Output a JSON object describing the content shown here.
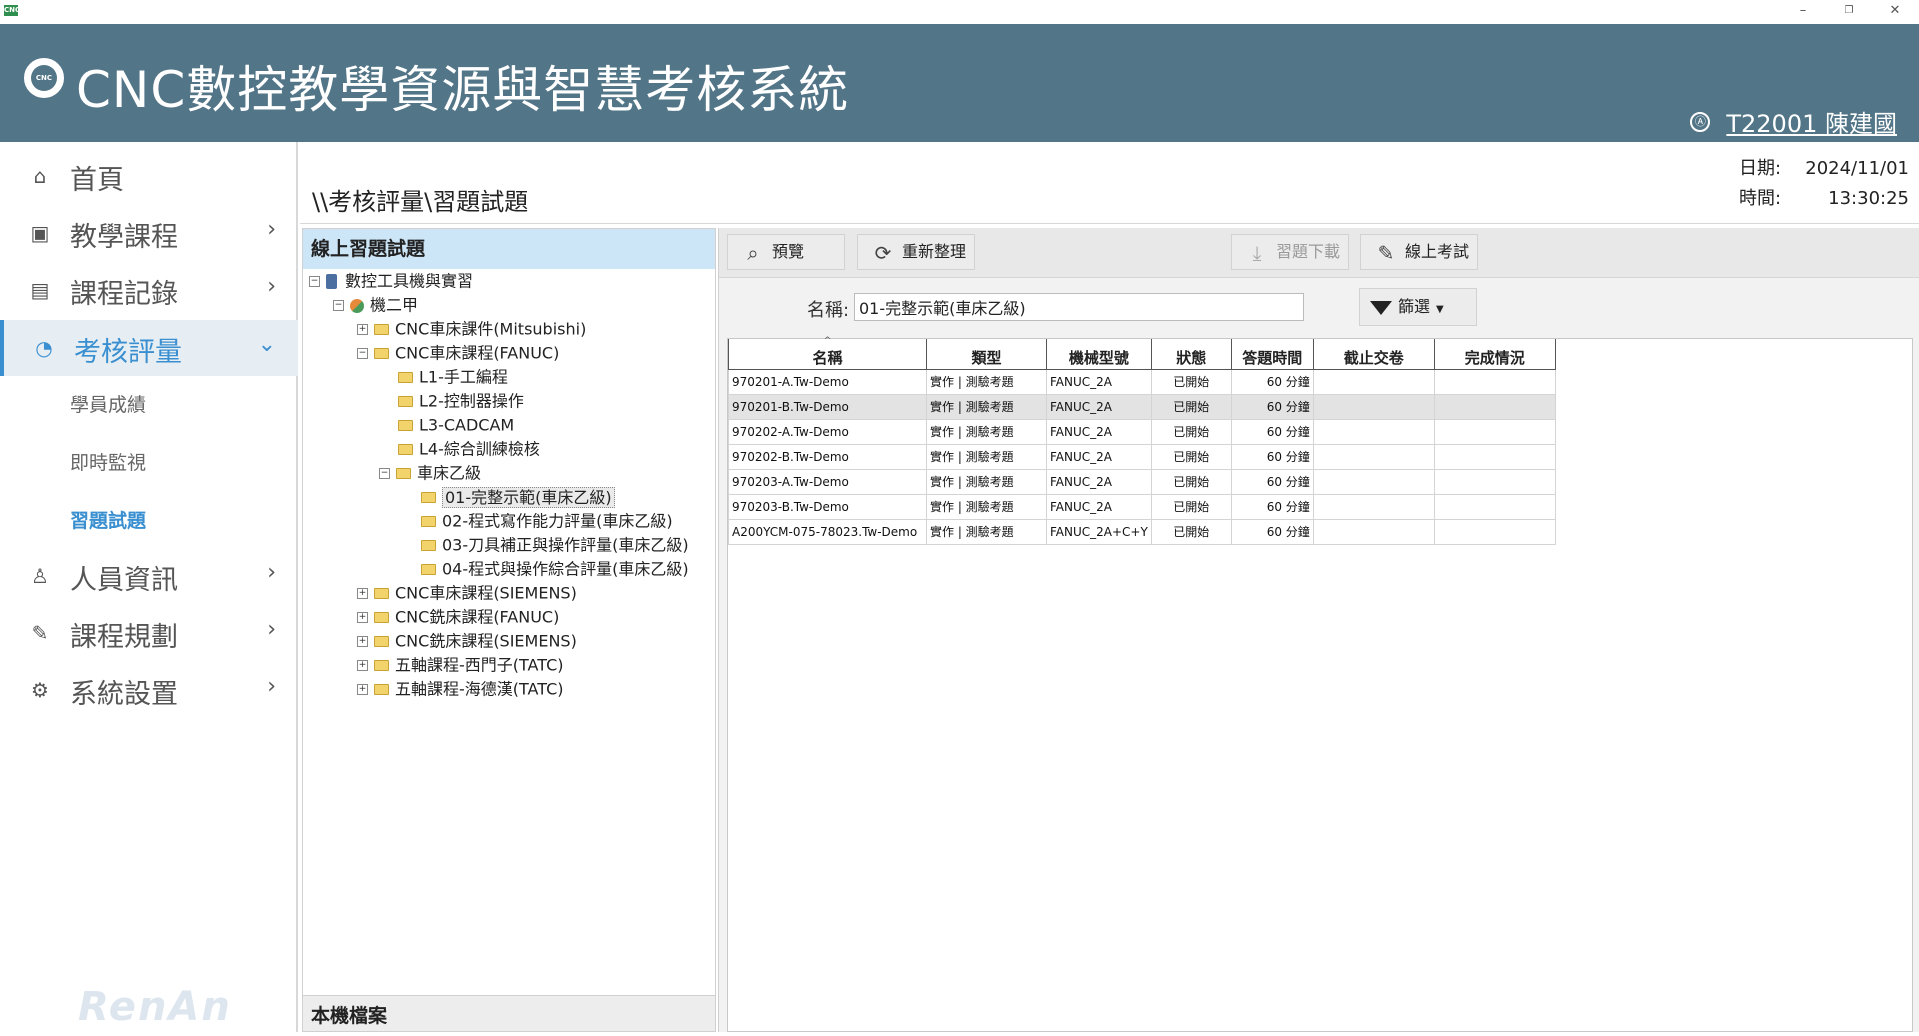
{
  "window": {
    "icon_text": "CNC",
    "minimize": "–",
    "restore": "❐",
    "close": "✕"
  },
  "header": {
    "logo_text": "CNC",
    "title": "CNC數控教學資源與智慧考核系統",
    "user_icon": "Ⓐ",
    "user": "T22001 陳建國"
  },
  "sidebar": {
    "items": [
      {
        "label": "首頁",
        "icon": "home-icon",
        "glyph": "⌂"
      },
      {
        "label": "教學課程",
        "icon": "cnc-icon",
        "glyph": "▣"
      },
      {
        "label": "課程記錄",
        "icon": "document-icon",
        "glyph": "▤"
      },
      {
        "label": "考核評量",
        "icon": "pie-chart-icon",
        "glyph": "◔"
      },
      {
        "label": "人員資訊",
        "icon": "person-icon",
        "glyph": "♙"
      },
      {
        "label": "課程規劃",
        "icon": "pencil-icon",
        "glyph": "✎"
      },
      {
        "label": "系統設置",
        "icon": "gear-icon",
        "glyph": "⚙"
      }
    ],
    "sub_items": [
      "學員成績",
      "即時監視",
      "習題試題"
    ],
    "watermark": "RenAn"
  },
  "content": {
    "breadcrumb": "\\\\考核評量\\習題試題",
    "date_label": "日期:",
    "date": "2024/11/01",
    "time_label": "時間:",
    "time": "13:30:25"
  },
  "tree": {
    "header": "線上習題試題",
    "footer": "本機檔案",
    "nodes": [
      {
        "label": "數控工具機與實習"
      },
      {
        "label": "機二甲"
      },
      {
        "label": "CNC車床課件(Mitsubishi)"
      },
      {
        "label": "CNC車床課程(FANUC)"
      },
      {
        "label": "L1-手工編程"
      },
      {
        "label": "L2-控制器操作"
      },
      {
        "label": "L3-CADCAM"
      },
      {
        "label": "L4-綜合訓練檢核"
      },
      {
        "label": "車床乙級"
      },
      {
        "label": "01-完整示範(車床乙級)"
      },
      {
        "label": "02-程式寫作能力評量(車床乙級)"
      },
      {
        "label": "03-刀具補正與操作評量(車床乙級)"
      },
      {
        "label": "04-程式與操作綜合評量(車床乙級)"
      },
      {
        "label": "CNC車床課程(SIEMENS)"
      },
      {
        "label": "CNC銑床課程(FANUC)"
      },
      {
        "label": "CNC銑床課程(SIEMENS)"
      },
      {
        "label": "五軸課程-西門子(TATC)"
      },
      {
        "label": "五軸課程-海德漢(TATC)"
      }
    ]
  },
  "toolbar": {
    "preview": "預覽",
    "refresh": "重新整理",
    "download": "習題下載",
    "online_exam": "線上考試"
  },
  "filter": {
    "name_label": "名稱:",
    "name_value": "01-完整示範(車床乙級)",
    "filter_label": "篩選"
  },
  "grid": {
    "sort_indicator": "^",
    "columns": [
      "名稱",
      "類型",
      "機械型號",
      "狀態",
      "答題時間",
      "截止交卷",
      "完成情況"
    ],
    "rows": [
      [
        "970201-A.Tw-Demo",
        "實作 | 測驗考題",
        "FANUC_2A",
        "已開始",
        "60 分鐘",
        "",
        ""
      ],
      [
        "970201-B.Tw-Demo",
        "實作 | 測驗考題",
        "FANUC_2A",
        "已開始",
        "60 分鐘",
        "",
        ""
      ],
      [
        "970202-A.Tw-Demo",
        "實作 | 測驗考題",
        "FANUC_2A",
        "已開始",
        "60 分鐘",
        "",
        ""
      ],
      [
        "970202-B.Tw-Demo",
        "實作 | 測驗考題",
        "FANUC_2A",
        "已開始",
        "60 分鐘",
        "",
        ""
      ],
      [
        "970203-A.Tw-Demo",
        "實作 | 測驗考題",
        "FANUC_2A",
        "已開始",
        "60 分鐘",
        "",
        ""
      ],
      [
        "970203-B.Tw-Demo",
        "實作 | 測驗考題",
        "FANUC_2A",
        "已開始",
        "60 分鐘",
        "",
        ""
      ],
      [
        "A200YCM-075-78023.Tw-Demo",
        "實作 | 測驗考題",
        "FANUC_2A+C+Y",
        "已開始",
        "60 分鐘",
        "",
        ""
      ]
    ]
  },
  "colors": {
    "header_bg": "#527587",
    "accent": "#3a8fd0",
    "tree_header_bg": "#cde6f7"
  }
}
